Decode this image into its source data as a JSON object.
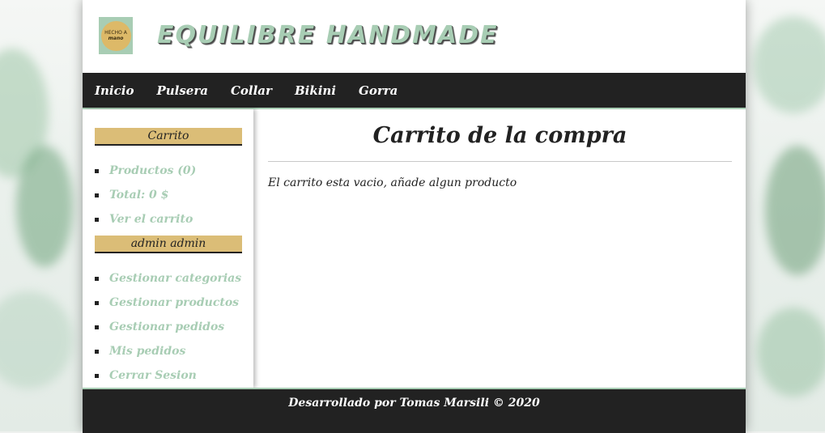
{
  "header": {
    "logo_text_line1": "HECHO A",
    "logo_text_line2": "mano",
    "brand": "EQUILIBRE HANDMADE"
  },
  "nav": {
    "items": [
      {
        "label": "Inicio"
      },
      {
        "label": "Pulsera"
      },
      {
        "label": "Collar"
      },
      {
        "label": "Bikini"
      },
      {
        "label": "Gorra"
      }
    ]
  },
  "sidebar": {
    "cart_title": "Carrito",
    "cart_items": [
      {
        "label": "Productos (0)"
      },
      {
        "label": "Total: 0 $"
      },
      {
        "label": "Ver el carrito"
      }
    ],
    "user_title": "admin admin",
    "user_items": [
      {
        "label": "Gestionar categorias"
      },
      {
        "label": "Gestionar productos"
      },
      {
        "label": "Gestionar pedidos"
      },
      {
        "label": "Mis pedidos"
      },
      {
        "label": "Cerrar Sesion"
      }
    ]
  },
  "main": {
    "title": "Carrito de la compra",
    "message": "El carrito esta vacio, añade algun producto"
  },
  "footer": {
    "text": "Desarrollado por Tomas Marsili © 2020"
  },
  "colors": {
    "accent_green": "#a8cdb4",
    "accent_gold": "#dbbd77",
    "dark": "#222222"
  }
}
